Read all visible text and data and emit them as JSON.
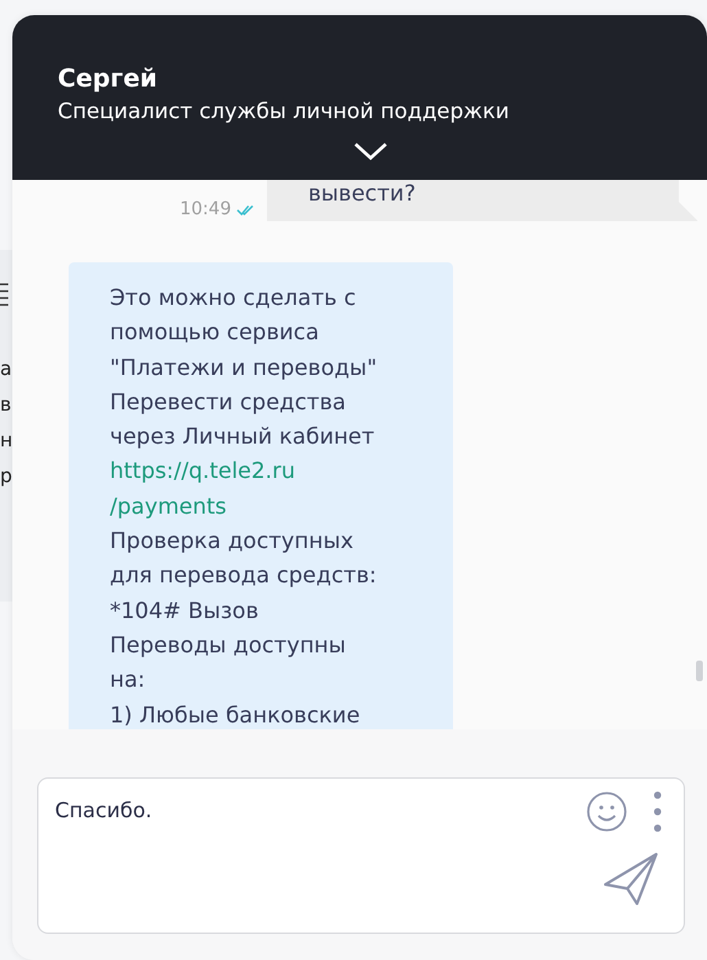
{
  "background_page": {
    "fragments": [
      "а",
      "в",
      "н",
      "р"
    ]
  },
  "header": {
    "name": "Сергей",
    "role": "Специалист службы личной поддержки"
  },
  "messages": [
    {
      "kind": "outgoing",
      "lines": [
        {
          "kind": "text",
          "text": "вывести?"
        }
      ],
      "time": "10:49",
      "read": true
    },
    {
      "kind": "incoming",
      "lines": [
        {
          "kind": "text",
          "text": "Это можно сделать с"
        },
        {
          "kind": "text",
          "text": "помощью сервиса"
        },
        {
          "kind": "text",
          "text": "\"Платежи и переводы\""
        },
        {
          "kind": "text",
          "text": "Перевести средства"
        },
        {
          "kind": "text",
          "text": "через Личный кабинет"
        },
        {
          "kind": "link",
          "text": "https://q.tele2.ru"
        },
        {
          "kind": "link",
          "text": "/payments"
        },
        {
          "kind": "text",
          "text": "Проверка доступных"
        },
        {
          "kind": "text",
          "text": "для перевода средств:"
        },
        {
          "kind": "text",
          "text": "*104# Вызов"
        },
        {
          "kind": "text",
          "text": "Переводы доступны"
        },
        {
          "kind": "text",
          "text": "на:"
        },
        {
          "kind": "text",
          "text": "1) Любые банковские"
        }
      ]
    }
  ],
  "composer": {
    "value": "Спасибо."
  }
}
